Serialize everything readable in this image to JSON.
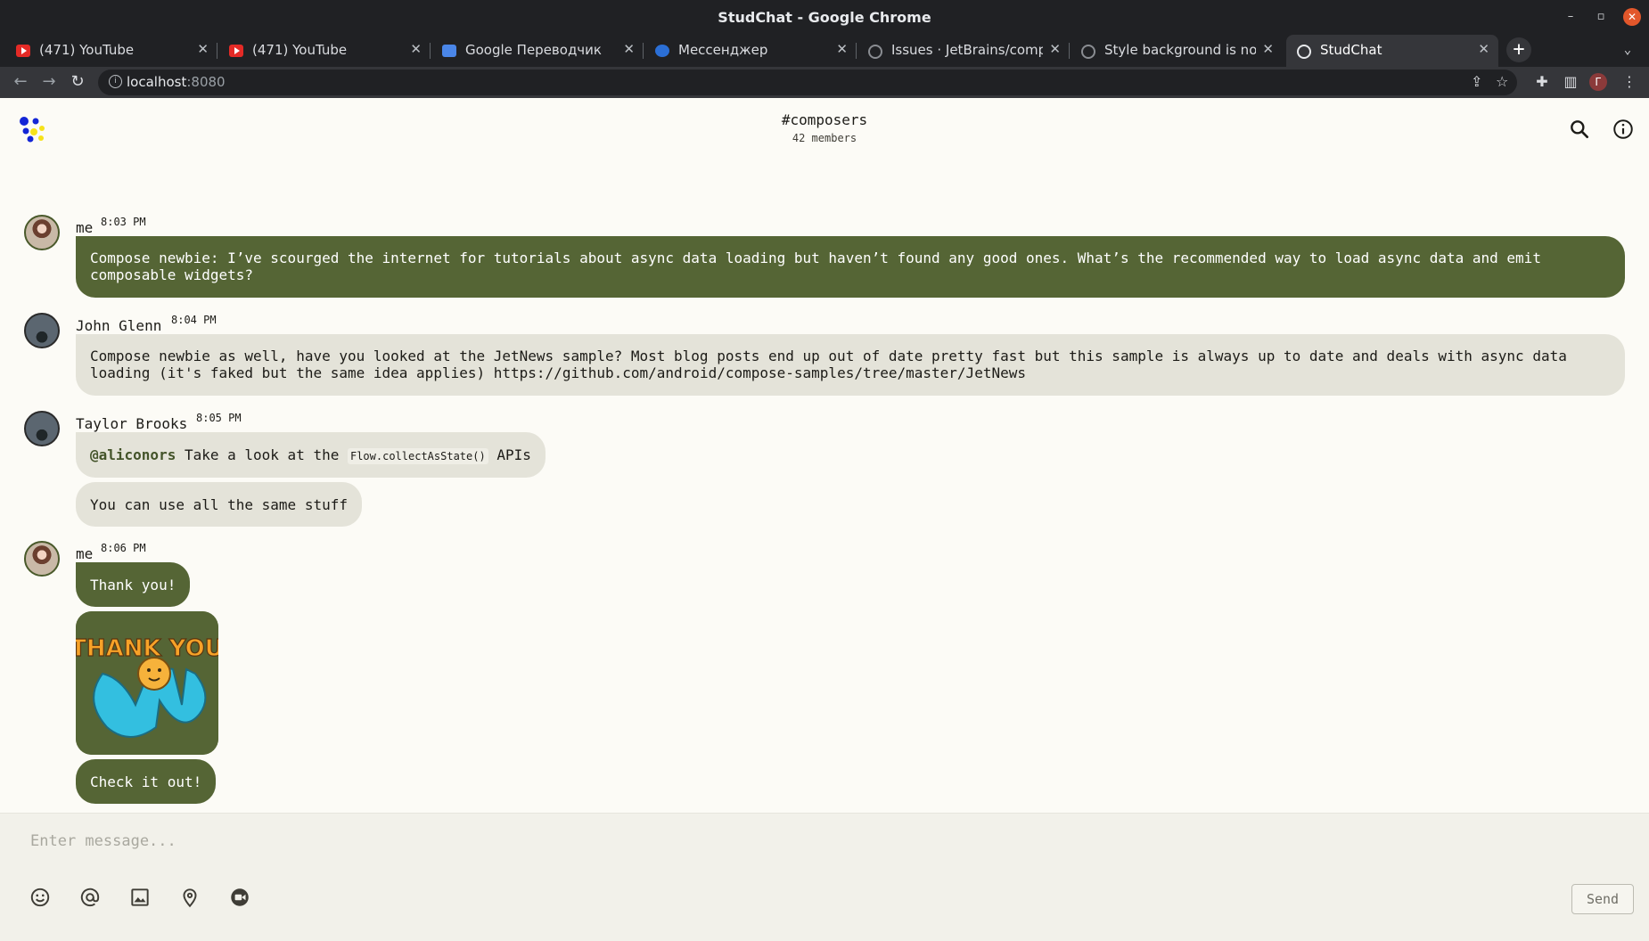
{
  "window": {
    "title": "StudChat - Google Chrome"
  },
  "tabs": [
    {
      "label": "(471) YouTube",
      "icon": "youtube-icon"
    },
    {
      "label": "(471) YouTube",
      "icon": "youtube-icon"
    },
    {
      "label": "Google Переводчик",
      "icon": "google-translate-icon"
    },
    {
      "label": "Мессенджер",
      "icon": "messenger-icon"
    },
    {
      "label": "Issues · JetBrains/compose",
      "icon": "github-icon"
    },
    {
      "label": "Style background is not applied",
      "icon": "github-icon"
    },
    {
      "label": "StudChat",
      "icon": "globe-icon",
      "active": true
    }
  ],
  "address_bar": {
    "host": "localhost",
    "port": ":8080"
  },
  "profile_initial": "Г",
  "channel": {
    "name": "#composers",
    "members": "42 members"
  },
  "messages": [
    {
      "author": "me",
      "time": "8:03 PM",
      "bubbles": [
        {
          "text": "Compose newbie: I’ve scourged the internet for tutorials about async data loading but haven’t found any good ones. What’s the recommended way to load async data and emit composable widgets?"
        }
      ]
    },
    {
      "author": "John Glenn",
      "time": "8:04 PM",
      "bubbles": [
        {
          "text": "Compose newbie as well, have you looked at the JetNews sample? Most blog posts end up out of date pretty fast but this sample is always up to date and deals with async data loading (it's faked but the same idea applies) ",
          "link": "https://github.com/android/compose-samples/tree/master/JetNews"
        }
      ]
    },
    {
      "author": "Taylor Brooks",
      "time": "8:05 PM",
      "bubbles": [
        {
          "mention": "@aliconors",
          "before_code": " Take a look at the ",
          "code": "Flow.collectAsState()",
          "after_code": " APIs"
        },
        {
          "text": "You can use all the same stuff"
        }
      ]
    },
    {
      "author": "me",
      "time": "8:06 PM",
      "bubbles": [
        {
          "text": "Thank you!"
        },
        {
          "sticker_text": "THANK YOU"
        },
        {
          "text": "Check it out!"
        }
      ]
    }
  ],
  "composer": {
    "placeholder": "Enter message...",
    "send_label": "Send"
  },
  "colors": {
    "mine_bubble": "#556535",
    "their_bubble": "#e4e3d9",
    "background": "#fcfbf6"
  }
}
